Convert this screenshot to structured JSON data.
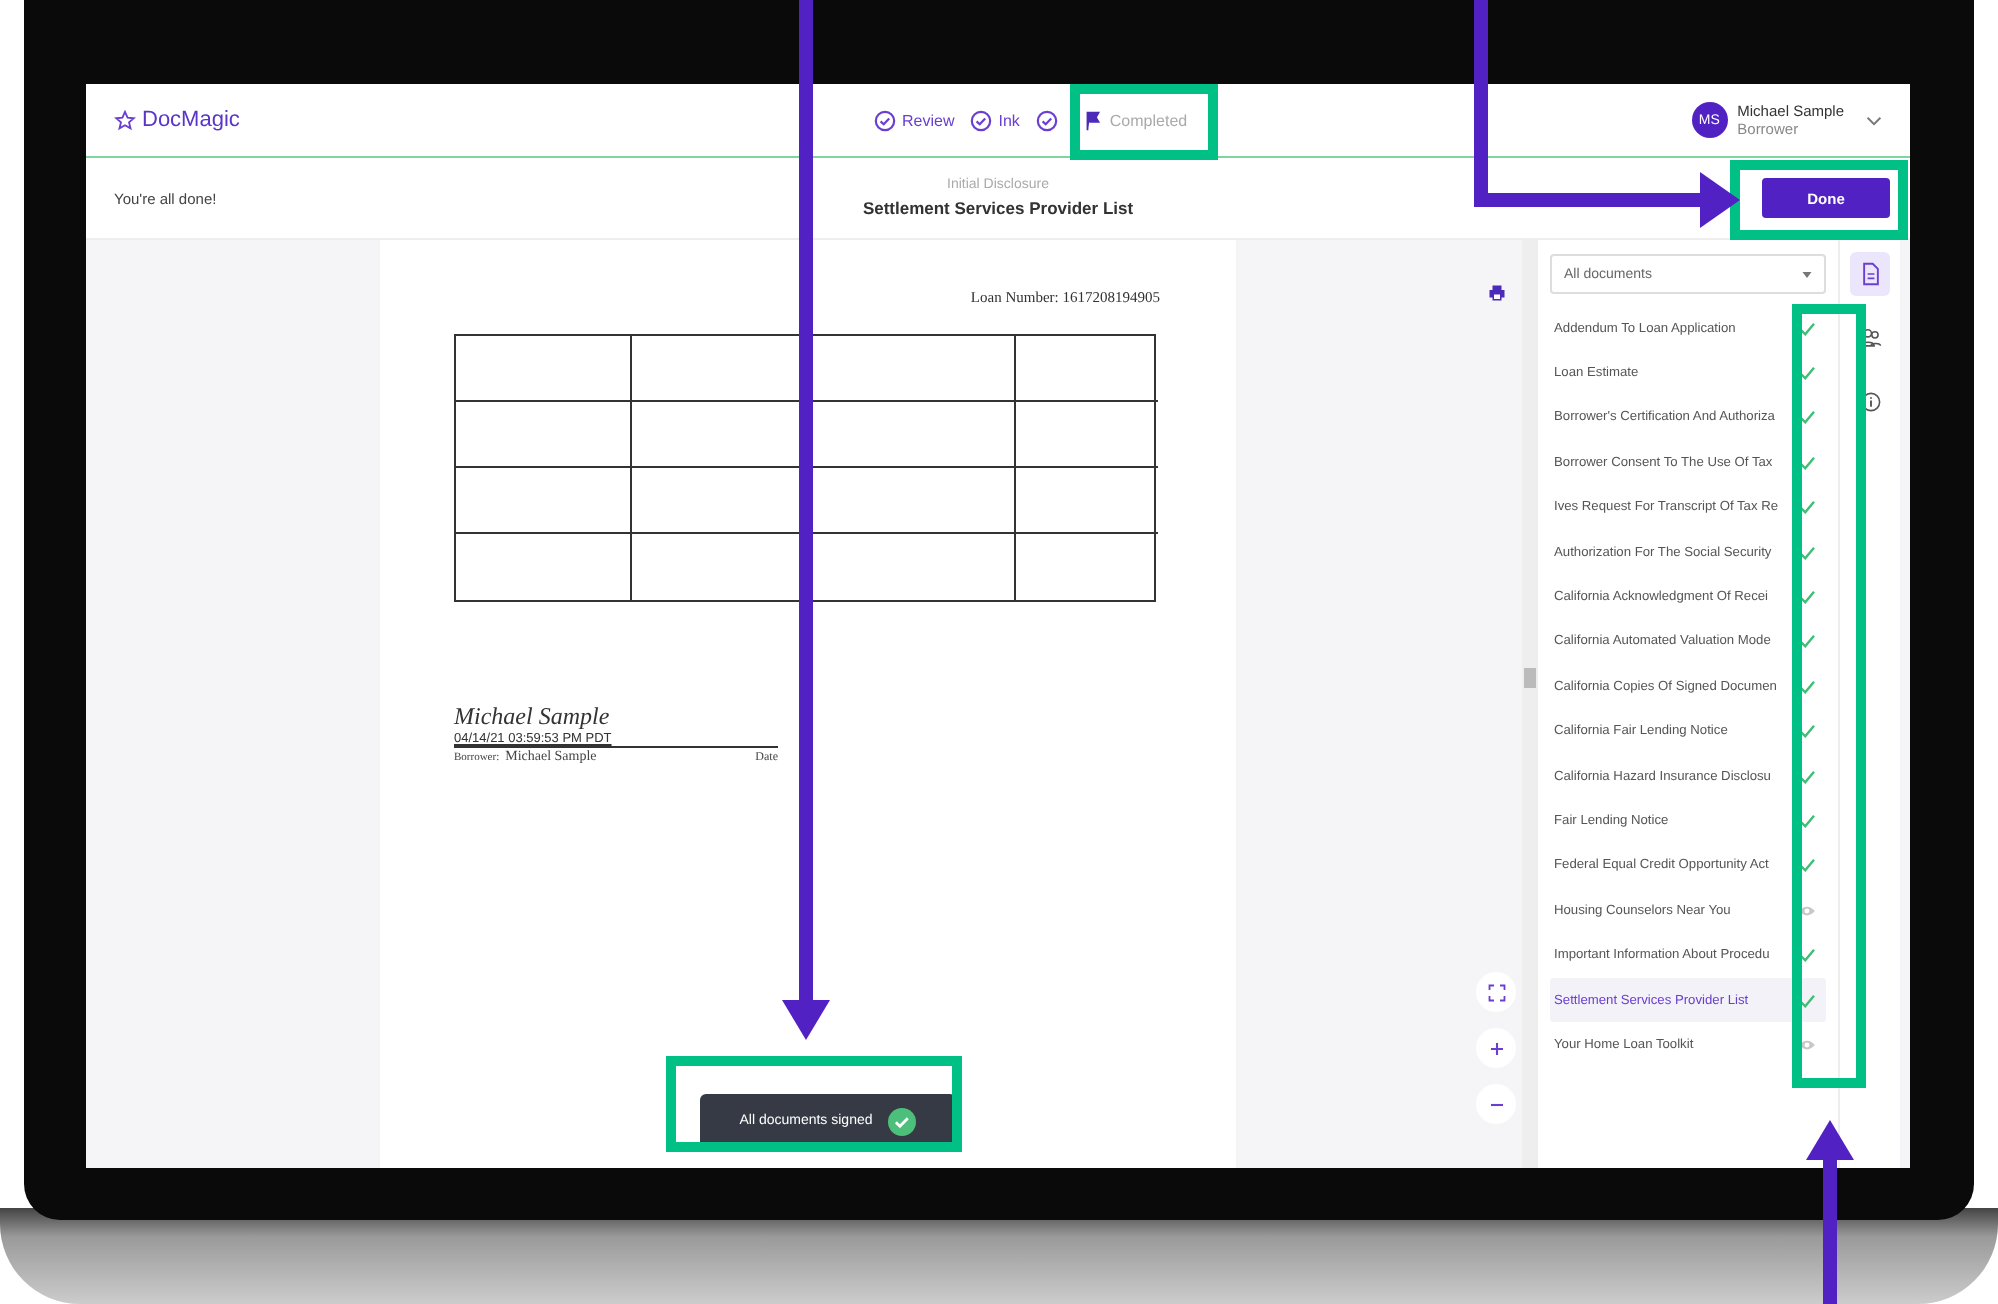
{
  "header": {
    "logo": "DocMagic"
  },
  "steps": [
    {
      "label": "Review",
      "kind": "check"
    },
    {
      "label": "Ink",
      "kind": "check"
    },
    {
      "kind": "check"
    },
    {
      "label": "Completed",
      "kind": "flag"
    }
  ],
  "user": {
    "initials": "MS",
    "name": "Michael Sample",
    "role": "Borrower"
  },
  "subheader": {
    "status": "You're all done!",
    "group": "Initial Disclosure",
    "title": "Settlement Services Provider List",
    "done_button": "Done"
  },
  "page": {
    "loan_number": "Loan Number: 1617208194905",
    "signature": "Michael Sample",
    "signed_at": "04/14/21 03:59:53 PM PDT",
    "borrower_label": "Borrower:",
    "borrower_name": "Michael Sample",
    "date_label": "Date"
  },
  "toast": {
    "text": "All documents signed"
  },
  "filter": {
    "value": "All documents"
  },
  "documents": [
    {
      "name": "Addendum To Loan Application",
      "signed": true,
      "selected": false
    },
    {
      "name": "Loan Estimate",
      "signed": true,
      "selected": false
    },
    {
      "name": "Borrower's Certification And Authoriza",
      "signed": true,
      "selected": false
    },
    {
      "name": "Borrower Consent To The Use Of Tax",
      "signed": true,
      "selected": false
    },
    {
      "name": "Ives Request For Transcript Of Tax Re",
      "signed": true,
      "selected": false
    },
    {
      "name": "Authorization For The Social Security",
      "signed": true,
      "selected": false
    },
    {
      "name": "California Acknowledgment Of Recei",
      "signed": true,
      "selected": false
    },
    {
      "name": "California Automated Valuation Mode",
      "signed": true,
      "selected": false
    },
    {
      "name": "California Copies Of Signed Documen",
      "signed": true,
      "selected": false
    },
    {
      "name": "California Fair Lending Notice",
      "signed": true,
      "selected": false
    },
    {
      "name": "California Hazard Insurance Disclosu",
      "signed": true,
      "selected": false
    },
    {
      "name": "Fair Lending Notice",
      "signed": true,
      "selected": false
    },
    {
      "name": "Federal Equal Credit Opportunity Act",
      "signed": true,
      "selected": false
    },
    {
      "name": "Housing Counselors Near You",
      "signed": false,
      "selected": false
    },
    {
      "name": "Important Information About Procedu",
      "signed": true,
      "selected": false
    },
    {
      "name": "Settlement Services Provider List",
      "signed": true,
      "selected": true
    },
    {
      "name": "Your Home Loan Toolkit",
      "signed": false,
      "selected": false
    }
  ],
  "rail": [
    {
      "kind": "document",
      "selected": true
    },
    {
      "kind": "people",
      "selected": false
    },
    {
      "kind": "info",
      "selected": false
    }
  ]
}
